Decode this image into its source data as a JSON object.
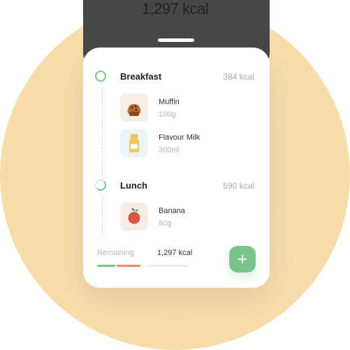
{
  "header": {
    "total_kcal": "1,297 kcal"
  },
  "meals": [
    {
      "name": "Breakfast",
      "kcal": "384 kcal",
      "progress": 1.0,
      "items": [
        {
          "name": "Muffin",
          "amount": "100g",
          "icon": "muffin-icon"
        },
        {
          "name": "Flavour Milk",
          "amount": "300ml",
          "icon": "milk-bottle-icon"
        }
      ]
    },
    {
      "name": "Lunch",
      "kcal": "590 kcal",
      "progress": 0.35,
      "items": [
        {
          "name": "Banana",
          "amount": "80g",
          "icon": "apple-icon"
        }
      ]
    }
  ],
  "summary": {
    "remaining_label": "Remaining",
    "remaining_value": "1,297 kcal"
  },
  "colors": {
    "accent_green": "#78c48b",
    "accent_orange": "#e7896f",
    "muted_bar": "#ededed"
  },
  "actions": {
    "add_icon": "plus-icon"
  }
}
